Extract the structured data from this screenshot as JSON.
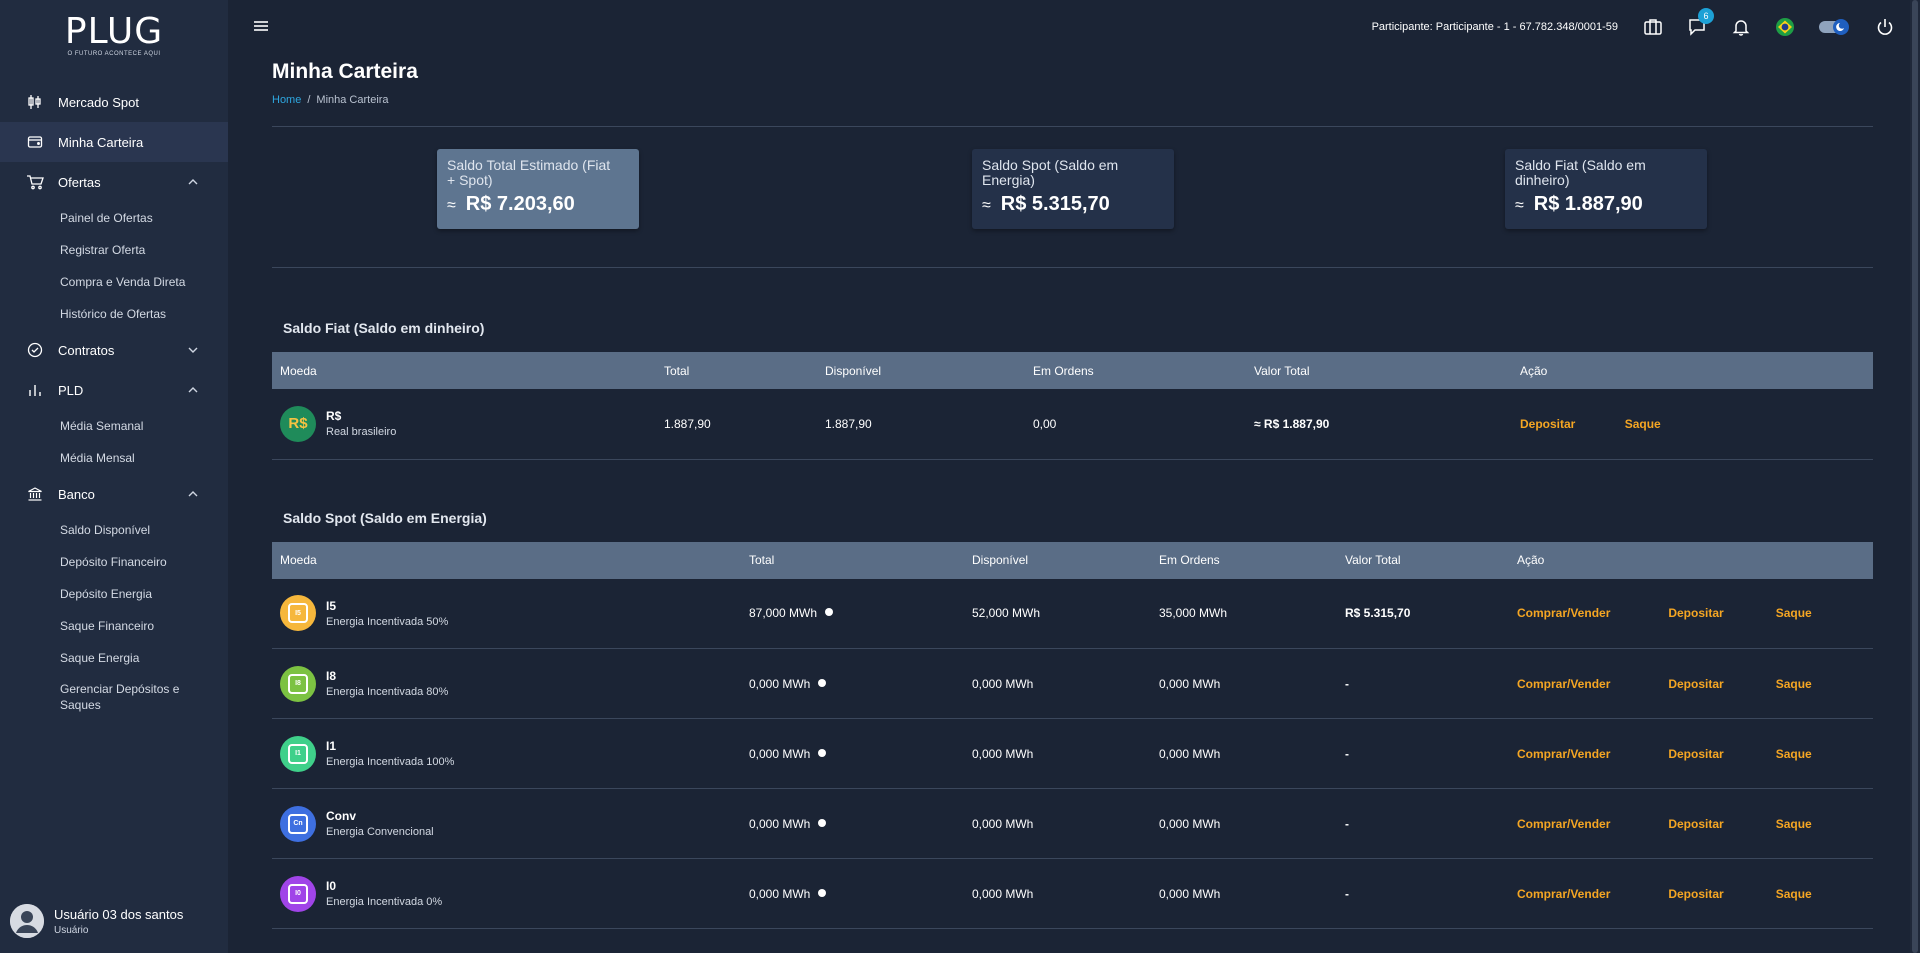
{
  "brand": {
    "logo": "PLUG",
    "tagline": "O FUTURO ACONTECE AQUI"
  },
  "sidebar": {
    "items": [
      {
        "label": "Mercado Spot",
        "icon": "candlestick-icon"
      },
      {
        "label": "Minha Carteira",
        "icon": "wallet-icon"
      },
      {
        "label": "Ofertas",
        "icon": "cart-icon",
        "sub": [
          "Painel de Ofertas",
          "Registrar Oferta",
          "Compra e Venda Direta",
          "Histórico de Ofertas"
        ]
      },
      {
        "label": "Contratos",
        "icon": "check-circle-icon"
      },
      {
        "label": "PLD",
        "icon": "bar-chart-icon",
        "sub": [
          "Média Semanal",
          "Média Mensal"
        ]
      },
      {
        "label": "Banco",
        "icon": "bank-icon",
        "sub": [
          "Saldo Disponível",
          "Depósito Financeiro",
          "Depósito Energia",
          "Saque Financeiro",
          "Saque Energia",
          "Gerenciar Depósitos e Saques"
        ]
      }
    ]
  },
  "user": {
    "name": "Usuário 03 dos santos",
    "role": "Usuário"
  },
  "topbar": {
    "participant": "Participante: Participante - 1 - 67.782.348/0001-59",
    "chat_badge": "6"
  },
  "page": {
    "title": "Minha Carteira",
    "breadcrumb_home": "Home",
    "breadcrumb_current": "Minha Carteira"
  },
  "summary": [
    {
      "title": "Saldo Total Estimado (Fiat + Spot)",
      "approx": "≈",
      "value": "R$ 7.203,60"
    },
    {
      "title": "Saldo Spot (Saldo em Energia)",
      "approx": "≈",
      "value": "R$ 5.315,70"
    },
    {
      "title": "Saldo Fiat (Saldo em dinheiro)",
      "approx": "≈",
      "value": "R$ 1.887,90"
    }
  ],
  "fiat": {
    "title": "Saldo Fiat (Saldo em dinheiro)",
    "headers": [
      "Moeda",
      "Total",
      "Disponível",
      "Em Ordens",
      "Valor Total",
      "Ação"
    ],
    "row": {
      "icon_text": "R$",
      "code": "R$",
      "name": "Real brasileiro",
      "total": "1.887,90",
      "available": "1.887,90",
      "orders": "0,00",
      "value_total": "≈  R$ 1.887,90",
      "action_deposit": "Depositar",
      "action_withdraw": "Saque"
    }
  },
  "spot": {
    "title": "Saldo Spot (Saldo em Energia)",
    "headers": [
      "Moeda",
      "Total",
      "Disponível",
      "Em Ordens",
      "Valor Total",
      "Ação"
    ],
    "actions": {
      "trade": "Comprar/Vender",
      "deposit": "Depositar",
      "withdraw": "Saque"
    },
    "rows": [
      {
        "code": "I5",
        "icon_text": "I5",
        "color": "#f6b73c",
        "name": "Energia Incentivada 50%",
        "total": "87,000 MWh",
        "available": "52,000 MWh",
        "orders": "35,000 MWh",
        "value_total": "R$ 5.315,70"
      },
      {
        "code": "I8",
        "icon_text": "I8",
        "color": "#7cc242",
        "name": "Energia Incentivada 80%",
        "total": "0,000 MWh",
        "available": "0,000 MWh",
        "orders": "0,000 MWh",
        "value_total": "-"
      },
      {
        "code": "I1",
        "icon_text": "I1",
        "color": "#3fd08a",
        "name": "Energia Incentivada 100%",
        "total": "0,000 MWh",
        "available": "0,000 MWh",
        "orders": "0,000 MWh",
        "value_total": "-"
      },
      {
        "code": "Conv",
        "icon_text": "Cn",
        "color": "#3e6fe0",
        "name": "Energia Convencional",
        "total": "0,000 MWh",
        "available": "0,000 MWh",
        "orders": "0,000 MWh",
        "value_total": "-"
      },
      {
        "code": "I0",
        "icon_text": "I0",
        "color": "#a044e8",
        "name": "Energia Incentivada 0%",
        "total": "0,000 MWh",
        "available": "0,000 MWh",
        "orders": "0,000 MWh",
        "value_total": "-"
      }
    ]
  }
}
